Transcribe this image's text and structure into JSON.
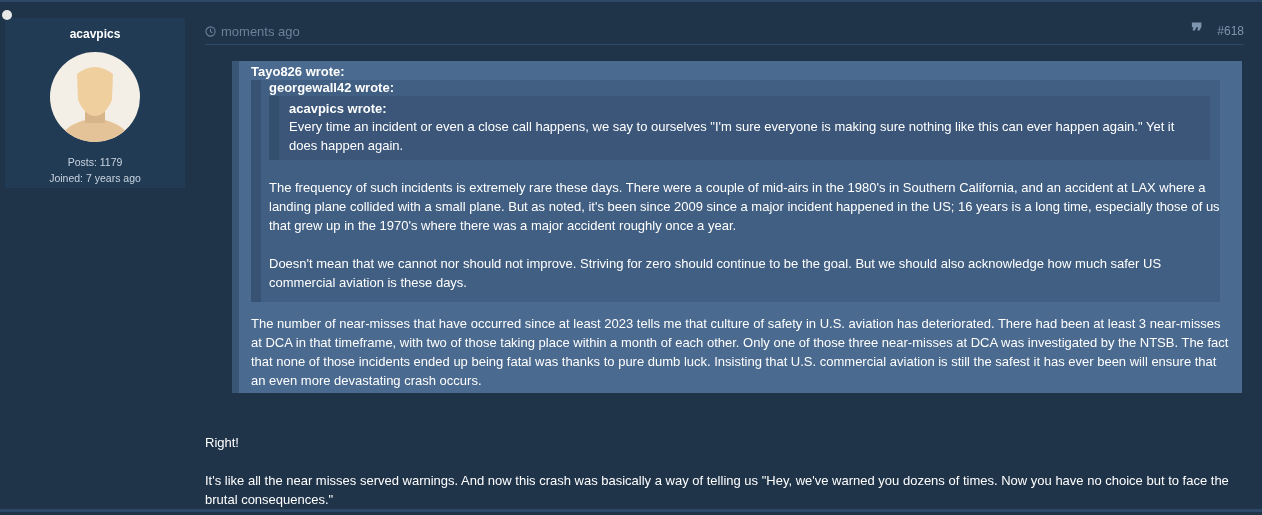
{
  "author": {
    "username": "acavpics",
    "online": true,
    "posts": "Posts: 1179",
    "joined": "Joined: 7 years ago"
  },
  "post": {
    "time": "moments ago",
    "quote_icon": "❞",
    "number": "#618",
    "quote": {
      "author": "Tayo826 wrote:",
      "text": "The number of near-misses that have occurred since at least 2023 tells me that culture of safety in U.S. aviation has deteriorated. There had been at least 3 near-misses at DCA in that timeframe, with two of those taking place within a month of each other. Only one of those three near-misses at DCA was investigated by the NTSB. The fact that none of those incidents ended up being fatal was thanks to pure dumb luck. Insisting that U.S. commercial aviation is still the safest it has ever been will ensure that an even more devastating crash occurs.",
      "children": [
        {
          "author": "georgewall42 wrote:",
          "paragraphs": [
            "The frequency of such incidents is extremely rare these days. There were a couple of mid-airs in the 1980's in Southern California, and an accident at LAX where a landing plane collided with a small plane. But as noted, it's been since 2009 since a major incident happened in the US; 16 years is a long time, especially those of us that grew up in the 1970's where there was a major accident roughly once a year.",
            "Doesn't mean that we cannot nor should not improve. Striving for zero should continue to be the goal. But we should also acknowledge how much safer US commercial aviation is these days."
          ],
          "children": [
            {
              "author": "acavpics wrote:",
              "paragraphs": [
                "Every time an incident or even a close call happens, we say to ourselves \"I'm sure everyone is making sure nothing like this can ever happen again.\" Yet it does happen again."
              ]
            }
          ]
        }
      ]
    },
    "paragraphs": [
      "Right!",
      "It's like all the near misses served warnings. And now this crash was basically a way of telling us \"Hey, we've warned you dozens of times. Now you have no choice but to face the brutal consequences.\""
    ]
  }
}
